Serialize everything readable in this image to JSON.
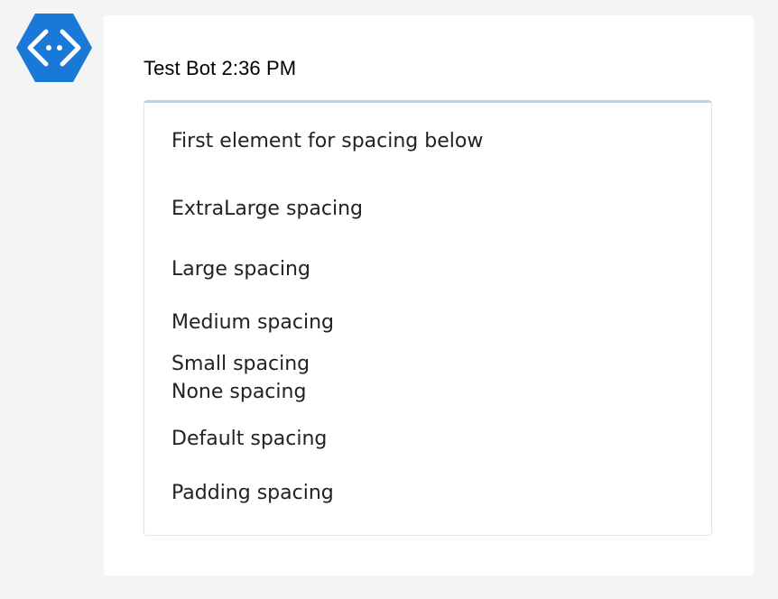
{
  "bot": {
    "avatar_icon": "bot-connector-icon",
    "avatar_color": "#1a78d6"
  },
  "message": {
    "sender": "Test Bot",
    "timestamp": "2:36 PM"
  },
  "card": {
    "accent_color": "#b8d3ef",
    "items": [
      "First element for spacing below",
      "ExtraLarge spacing",
      "Large spacing",
      "Medium spacing",
      "Small spacing",
      "None spacing",
      "Default spacing",
      "Padding spacing"
    ]
  }
}
